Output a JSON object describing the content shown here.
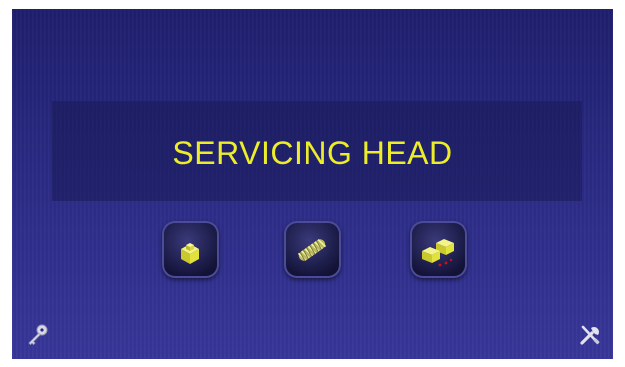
{
  "screen": {
    "title": "SERVICING HEAD"
  },
  "buttons": [
    {
      "id": "single-block",
      "icon": "single-block-icon"
    },
    {
      "id": "spring",
      "icon": "spring-icon"
    },
    {
      "id": "double-block",
      "icon": "double-block-icon"
    }
  ],
  "corner_icons": {
    "left": "key-icon",
    "right": "tools-icon"
  },
  "colors": {
    "title": "#eded2a",
    "background": "#2a2a84",
    "icon_yellow": "#e8e84a",
    "accent_red": "#cc1111"
  }
}
